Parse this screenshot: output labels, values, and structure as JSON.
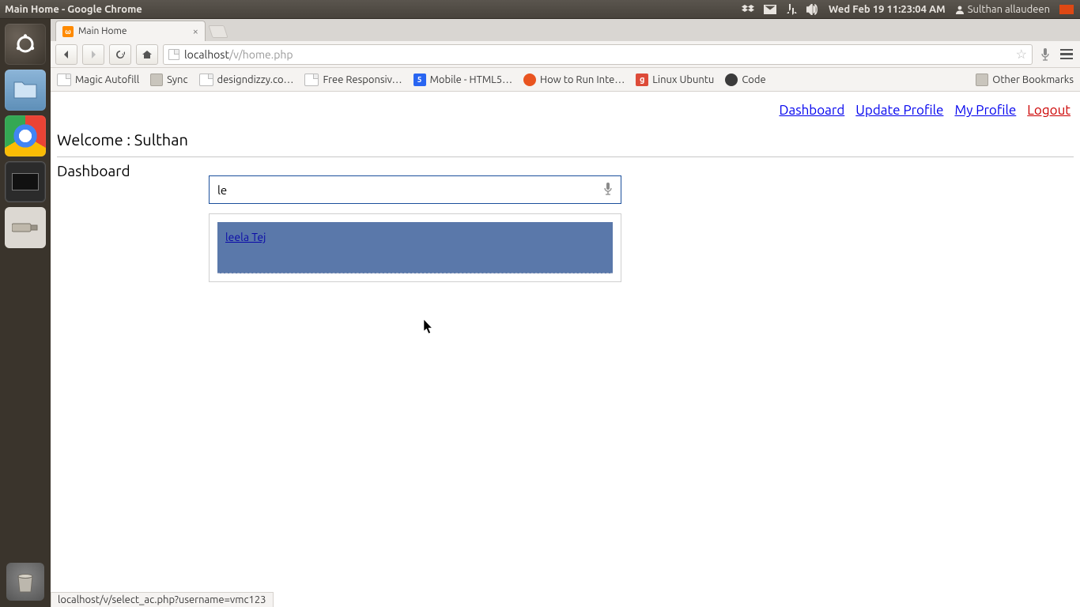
{
  "menubar": {
    "window_title": "Main Home - Google Chrome",
    "datetime": "Wed Feb 19 11:23:04 AM",
    "username": "Sulthan allaudeen"
  },
  "tabs": [
    {
      "title": "Main Home"
    }
  ],
  "toolbar": {
    "url_host": "localhost",
    "url_path": "/v/home.php"
  },
  "bookmarks": {
    "items": [
      {
        "label": "Magic Autofill",
        "kind": "page"
      },
      {
        "label": "Sync",
        "kind": "folder"
      },
      {
        "label": "designdizzy.co…",
        "kind": "page"
      },
      {
        "label": "Free Responsiv…",
        "kind": "page"
      },
      {
        "label": "Mobile - HTML5…",
        "kind": "html5"
      },
      {
        "label": "How to Run Inte…",
        "kind": "ubuntu"
      },
      {
        "label": "Linux Ubuntu",
        "kind": "gplus"
      },
      {
        "label": "Code",
        "kind": "grey"
      }
    ],
    "other_label": "Other Bookmarks"
  },
  "page": {
    "nav": {
      "dashboard": "Dashboard",
      "update_profile": "Update Profile",
      "my_profile": "My Profile",
      "logout": "Logout"
    },
    "welcome": "Welcome : Sulthan",
    "section": "Dashboard",
    "search_value": "le",
    "suggestion": "leela Tej",
    "status": "localhost/v/select_ac.php?username=vmc123"
  }
}
